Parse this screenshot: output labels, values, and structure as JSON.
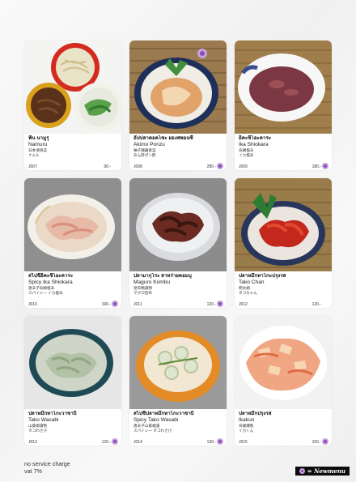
{
  "items": [
    {
      "thai": "ฟัน นามูรุ",
      "roman": "Namuru",
      "jp1": "日本清祥菜",
      "jp2": "ナムル",
      "code": "J007",
      "price": "90.-",
      "dot_color": "#b98ad8"
    },
    {
      "thai": "อัปปลาคอคโซะ ยองสพอนซี",
      "roman": "Akimo Ponzu",
      "jp1": "柚子麺醤香菜",
      "jp2": "あん肝ポン酢",
      "code": "J008",
      "price": "280.-",
      "dot_color": "#b98ad8"
    },
    {
      "thai": "อิคะชิโอะคาระ",
      "roman": "Ika Shiokara",
      "jp1": "烏賊塩辛",
      "jp2": "イカ塩辛",
      "code": "J009",
      "price": "180.-",
      "dot_color": "#b98ad8"
    },
    {
      "thai": "สไปซี่อิคะชิโอะคาระ",
      "roman": "Spicy Ika Shiokara",
      "jp1": "唐辛子烏賊塩辛",
      "jp2": "スパイシー イカ塩辛",
      "code": "J010",
      "price": "190.-",
      "dot_color": "#b98ad8"
    },
    {
      "thai": "ปลามากุโระ สาหร่ายคอมบุ",
      "roman": "Maguro Kombu",
      "jp1": "昆布鮪漬物",
      "jp2": "マグロ昆布",
      "code": "J011",
      "price": "120.-",
      "dot_color": "#b98ad8"
    },
    {
      "thai": "ปลาหมึกทาโกะปรุงรส",
      "roman": "Tako Chan",
      "jp1": "明太蛸",
      "jp2": "タコちゃん",
      "code": "J012",
      "price": "120.-",
      "dot_color": "#b98ad8"
    },
    {
      "thai": "ปลาหมึกทาโกะวาซาบิ",
      "roman": "Tako Wasabi",
      "jp1": "山葵蛸漬物",
      "jp2": "タコわさび",
      "code": "J013",
      "price": "120.-",
      "dot_color": "#b98ad8"
    },
    {
      "thai": "สไปซี่ปลาหมึกทาโกะวาซาบิ",
      "roman": "Spicy Tako Wasabi",
      "jp1": "唐辛子山葵蛸漬",
      "jp2": "スパイシー タコわさび",
      "code": "J014",
      "price": "130.-",
      "dot_color": "#b98ad8"
    },
    {
      "thai": "ปลาหมึกปรุงรส",
      "roman": "Ikakun",
      "jp1": "烏賊燻製",
      "jp2": "イカくん",
      "code": "J015",
      "price": "150.-",
      "dot_color": "#b98ad8"
    }
  ],
  "footer": {
    "line1": "no service charge",
    "line2": "vat 7%"
  },
  "legend": {
    "label": "= Newmenu"
  }
}
